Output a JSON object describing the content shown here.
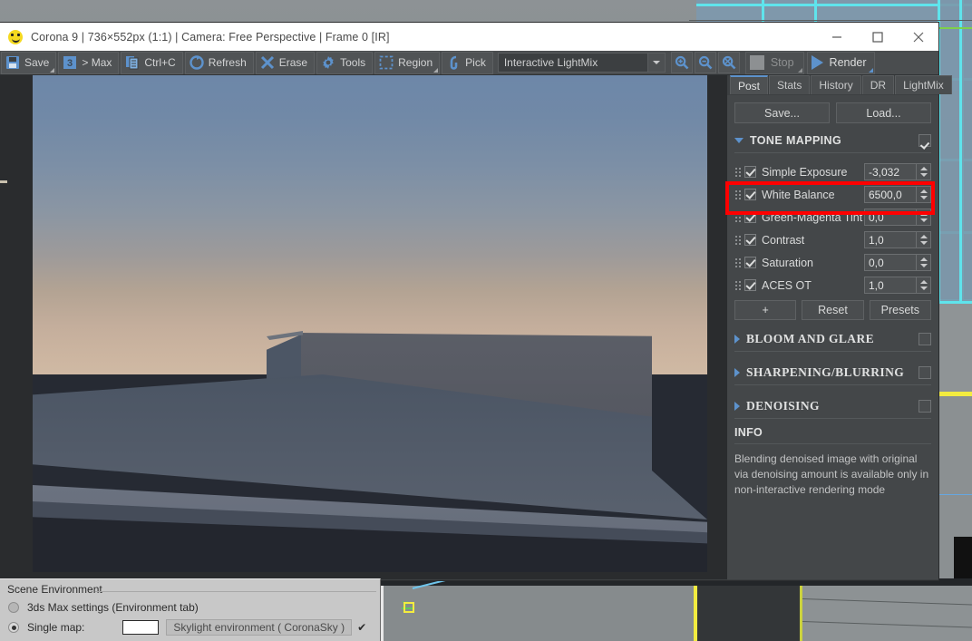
{
  "window": {
    "title": "Corona 9 | 736×552px (1:1) | Camera: Free Perspective | Frame 0 [IR]",
    "icon": "smiley-icon",
    "minimize": "minimize-icon",
    "maximize": "maximize-icon",
    "close": "close-icon"
  },
  "toolbar": {
    "buttons": [
      {
        "label": "Save",
        "icon": "floppy-disk-icon"
      },
      {
        "label": "> Max",
        "icon": "3-number-icon"
      },
      {
        "label": "Ctrl+C",
        "icon": "copy-icon"
      },
      {
        "label": "Refresh",
        "icon": "refresh-icon"
      },
      {
        "label": "Erase",
        "icon": "x-cross-icon"
      },
      {
        "label": "Tools",
        "icon": "gear-icon"
      },
      {
        "label": "Region",
        "icon": "marquee-region-icon"
      },
      {
        "label": "Pick",
        "icon": "eyedropper-pick-icon"
      }
    ],
    "lightmix_select": "Interactive LightMix",
    "zoom_in": "zoom-in-icon",
    "zoom_out": "zoom-out-icon",
    "zoom_fit": "zoom-fit-icon",
    "stop_label": "Stop",
    "render_label": "Render"
  },
  "panel": {
    "tabs": [
      {
        "label": "Post",
        "active": true
      },
      {
        "label": "Stats",
        "active": false
      },
      {
        "label": "History",
        "active": false
      },
      {
        "label": "DR",
        "active": false
      },
      {
        "label": "LightMix",
        "active": false
      }
    ],
    "save_label": "Save...",
    "load_label": "Load...",
    "tone_mapping": {
      "title": "TONE MAPPING",
      "enabled": true,
      "rows": [
        {
          "label": "Simple Exposure",
          "value": "-3,032",
          "checked": true,
          "highlighted": true
        },
        {
          "label": "White Balance",
          "value": "6500,0",
          "checked": true,
          "highlighted": false
        },
        {
          "label": "Green-Magenta Tint",
          "value": "0,0",
          "checked": true,
          "highlighted": false
        },
        {
          "label": "Contrast",
          "value": "1,0",
          "checked": true,
          "highlighted": false
        },
        {
          "label": "Saturation",
          "value": "0,0",
          "checked": true,
          "highlighted": false
        },
        {
          "label": "ACES OT",
          "value": "1,0",
          "checked": true,
          "highlighted": false
        }
      ],
      "add_label": "+",
      "reset_label": "Reset",
      "presets_label": "Presets"
    },
    "sections": [
      {
        "title": "BLOOM AND GLARE",
        "enabled": false
      },
      {
        "title": "SHARPENING/BLURRING",
        "enabled": false
      },
      {
        "title": "DENOISING",
        "enabled": false
      }
    ],
    "info": {
      "title": "INFO",
      "text": "Blending denoised image with original via denoising amount is available only in non-interactive rendering mode"
    }
  },
  "bottom_dialog": {
    "group_label": "Scene Environment",
    "option_max": "3ds Max settings (Environment tab)",
    "option_single": "Single map:",
    "map_name": "Skylight environment  ( CoronaSky )",
    "map_enabled_icon": "checkmark-icon",
    "color_swatch": "#ffffff"
  },
  "colors": {
    "accent_blue": "#5d92cc",
    "highlight_red": "#ff0000",
    "panel_bg": "#444749",
    "toolbar_bg": "#4a4d4f"
  }
}
